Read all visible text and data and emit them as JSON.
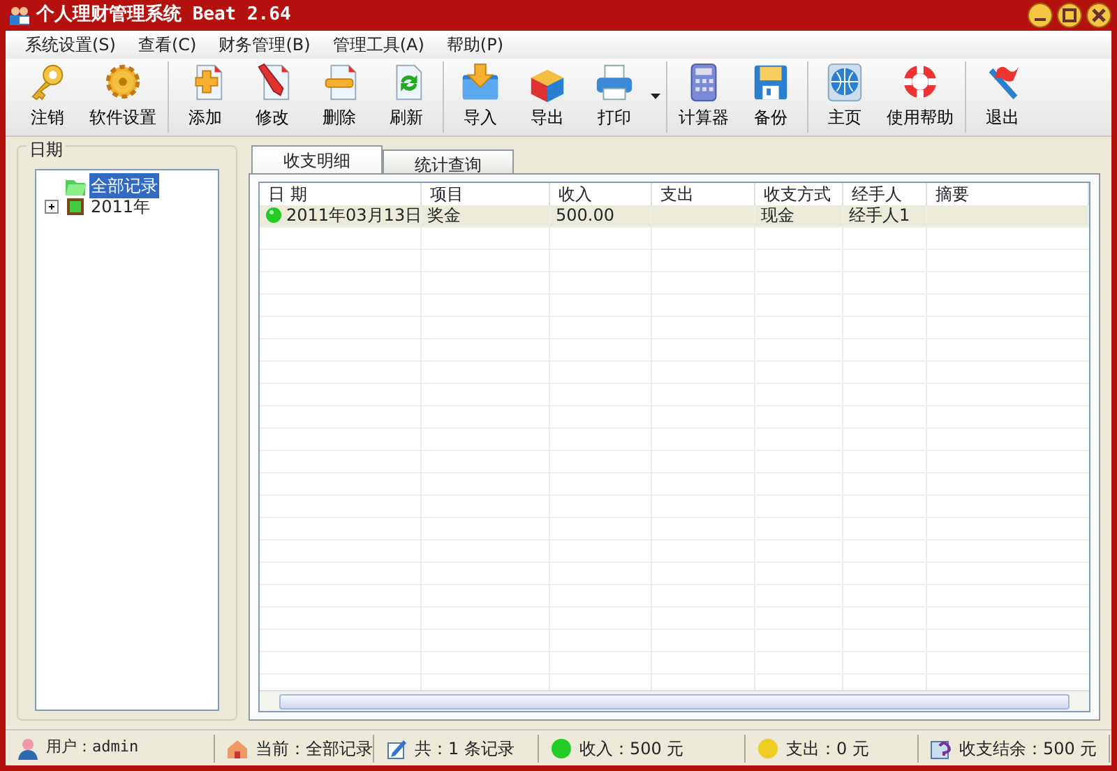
{
  "window": {
    "title": "个人理财管理系统 Beat 2.64"
  },
  "menu": [
    "系统设置(S)",
    "查看(C)",
    "财务管理(B)",
    "管理工具(A)",
    "帮助(P)"
  ],
  "toolbar": [
    [
      {
        "label": "注销",
        "kind": "key"
      },
      {
        "label": "软件设置",
        "kind": "gear"
      }
    ],
    [
      {
        "label": "添加",
        "kind": "add"
      },
      {
        "label": "修改",
        "kind": "edit"
      },
      {
        "label": "删除",
        "kind": "remove"
      },
      {
        "label": "刷新",
        "kind": "refresh"
      }
    ],
    [
      {
        "label": "导入",
        "kind": "import"
      },
      {
        "label": "导出",
        "kind": "export"
      },
      {
        "label": "打印",
        "kind": "print",
        "dropdown": true
      }
    ],
    [
      {
        "label": "计算器",
        "kind": "calculator"
      },
      {
        "label": "备份",
        "kind": "disk"
      }
    ],
    [
      {
        "label": "主页",
        "kind": "globe"
      },
      {
        "label": "使用帮助",
        "kind": "lifebuoy"
      }
    ],
    [
      {
        "label": "退出",
        "kind": "exit"
      }
    ]
  ],
  "sidebar": {
    "title": "日期",
    "tree": [
      {
        "label": "全部记录",
        "selected": true,
        "kind": "folder"
      },
      {
        "label": "2011年",
        "selected": false,
        "kind": "year",
        "expanded": false
      }
    ]
  },
  "tabs": [
    {
      "label": "收支明细",
      "selected": true
    },
    {
      "label": "统计查询",
      "selected": false
    }
  ],
  "table": {
    "columns": [
      "日 期",
      "项目",
      "收入",
      "支出",
      "收支方式",
      "经手人",
      "摘要"
    ],
    "rows": [
      {
        "cells": [
          "2011年03月13日",
          "奖金",
          "500.00",
          "",
          "现金",
          "经手人1",
          ""
        ],
        "selected": true
      }
    ]
  },
  "status_bar": [
    {
      "text": "用户：admin",
      "kind": "user"
    },
    {
      "text": "当前：全部记录",
      "kind": "home"
    },
    {
      "text": "共：1 条记录",
      "kind": "edit"
    },
    {
      "text": "收入：500 元",
      "kind": "green"
    },
    {
      "text": "支出：0 元",
      "kind": "yellow"
    },
    {
      "text": "收支结余：500 元",
      "kind": "help"
    }
  ]
}
